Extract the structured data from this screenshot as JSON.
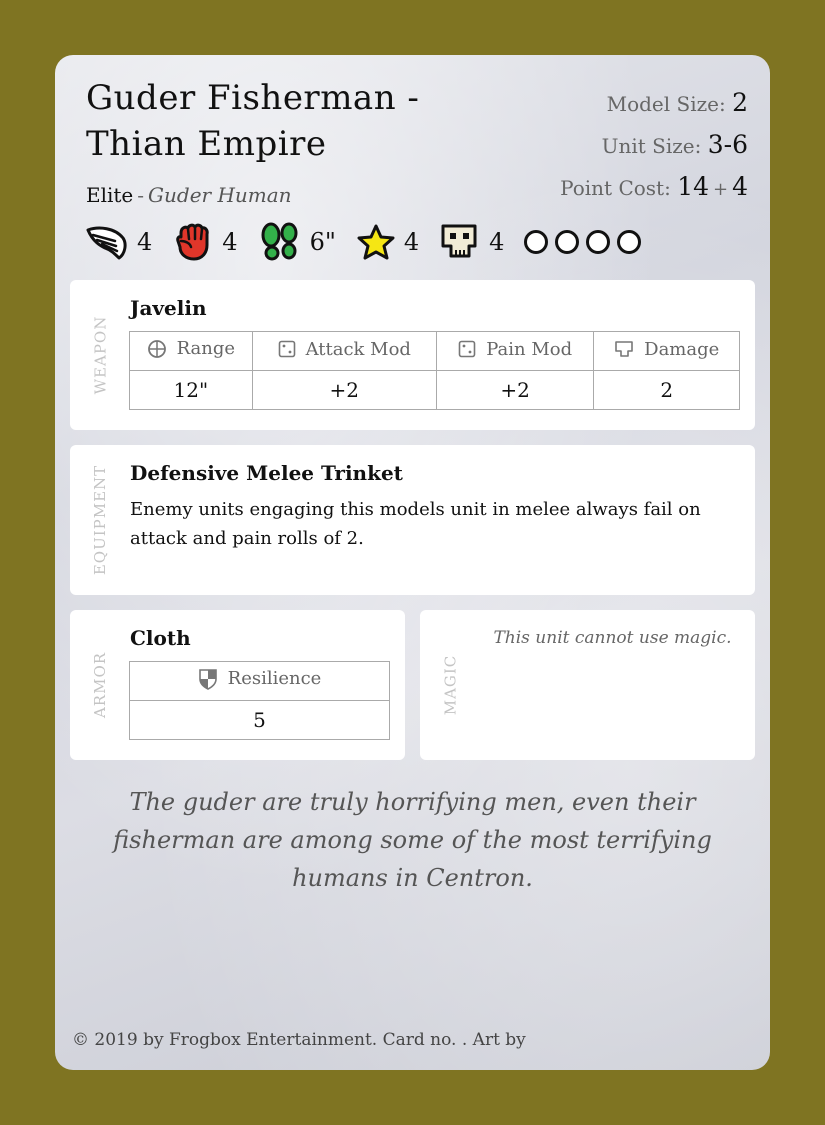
{
  "card": {
    "title": "Guder Fisherman - Thian Empire",
    "type": "Elite",
    "race": "Guder Human",
    "model_size_label": "Model Size:",
    "model_size": "2",
    "unit_size_label": "Unit Size:",
    "unit_size": "3-6",
    "point_cost_label": "Point Cost:",
    "point_cost_base": "14",
    "point_cost_extra": "4",
    "colors": {
      "border": "#7f7422",
      "fist": "#e0362a",
      "feet": "#33b04a",
      "star": "#f5e614"
    }
  },
  "stats": [
    {
      "icon": "wing-icon",
      "value": "4"
    },
    {
      "icon": "fist-icon",
      "value": "4"
    },
    {
      "icon": "footprints-icon",
      "value": "6\""
    },
    {
      "icon": "star-icon",
      "value": "4"
    },
    {
      "icon": "skull-icon",
      "value": "4"
    }
  ],
  "health_pips": 4,
  "weapon": {
    "section_label": "WEAPON",
    "name": "Javelin",
    "headers": [
      "Range",
      "Attack Mod",
      "Pain Mod",
      "Damage"
    ],
    "values": [
      "12\"",
      "+2",
      "+2",
      "2"
    ]
  },
  "equipment": {
    "section_label": "EQUIPMENT",
    "name": "Defensive Melee Trinket",
    "description": "Enemy units engaging this models unit in melee always fail on attack and pain rolls of 2."
  },
  "armor": {
    "section_label": "ARMOR",
    "name": "Cloth",
    "header": "Resilience",
    "value": "5"
  },
  "magic": {
    "section_label": "MAGIC",
    "note": "This unit cannot use magic."
  },
  "flavor": "The guder are truly horrifying men, even their fisherman are among some of the most terrifying humans in Centron.",
  "footer": "© 2019 by Frogbox Entertainment. Card no. . Art by"
}
